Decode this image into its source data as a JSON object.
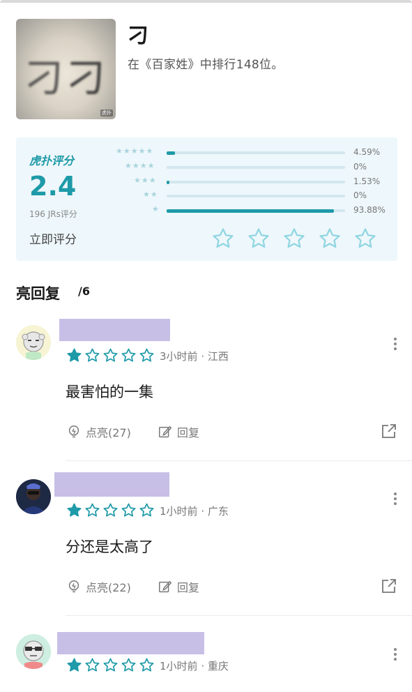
{
  "header": {
    "title": "刁",
    "subtitle": "在《百家姓》中排行148位。",
    "image_watermark": "虎扑"
  },
  "rating": {
    "brand_label": "虎扑评分",
    "score": "2.4",
    "count_label": "196 JRs评分",
    "rate_now_label": "立即评分",
    "distribution": [
      {
        "stars": 5,
        "percent_label": "4.59%",
        "percent": 4.59
      },
      {
        "stars": 4,
        "percent_label": "0%",
        "percent": 0
      },
      {
        "stars": 3,
        "percent_label": "1.53%",
        "percent": 1.53
      },
      {
        "stars": 2,
        "percent_label": "0%",
        "percent": 0
      },
      {
        "stars": 1,
        "percent_label": "93.88%",
        "percent": 93.88
      }
    ],
    "accent_color": "#1e9aa8"
  },
  "replies": {
    "title": "亮回复",
    "count": "/6",
    "items": [
      {
        "rating": 1,
        "time": "3小时前",
        "location": "· 江西",
        "content": "最害怕的一集",
        "like_label": "点亮(27)",
        "reply_label": "回复",
        "avatar": "cartoon-face"
      },
      {
        "rating": 1,
        "time": "1小时前",
        "location": "· 广东",
        "content": "分还是太高了",
        "like_label": "点亮(22)",
        "reply_label": "回复",
        "avatar": "masked-figure"
      },
      {
        "rating": 1,
        "time": "1小时前",
        "location": "· 重庆",
        "content": "",
        "like_label": "",
        "reply_label": "",
        "avatar": "cartoon-sunglasses"
      }
    ]
  }
}
